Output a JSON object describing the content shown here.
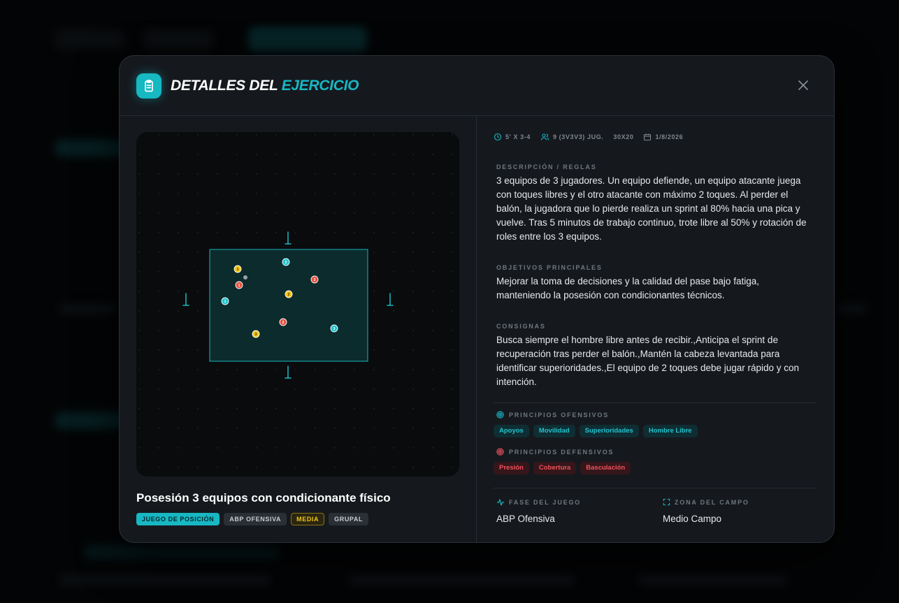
{
  "modal": {
    "title_main": "DETALLES DEL",
    "title_accent": "EJERCICIO",
    "icon": "clipboard-icon",
    "close_icon": "close-icon"
  },
  "exercise": {
    "title": "Posesión 3 equipos con condicionante físico",
    "tags": [
      "JUEGO DE POSICIÓN",
      "ABP OFENSIVA",
      "MEDIA",
      "GRUPAL"
    ]
  },
  "meta": {
    "duration": "5' X 3-4",
    "players": "9 (3V3V3) JUG.",
    "dimensions": "30X20",
    "date": "1/8/2026"
  },
  "description": {
    "label": "DESCRIPCIÓN / REGLAS",
    "text": "3 equipos de 3 jugadores. Un equipo defiende, un equipo atacante juega con toques libres y el otro atacante con máximo 2 toques. Al perder el balón, la jugadora que lo pierde realiza un sprint al 80% hacia una pica y vuelve. Tras 5 minutos de trabajo continuo, trote libre al 50% y rotación de roles entre los 3 equipos."
  },
  "objectives": {
    "label": "OBJETIVOS PRINCIPALES",
    "text": "Mejorar la toma de decisiones y la calidad del pase bajo fatiga, manteniendo la posesión con condicionantes técnicos."
  },
  "consignas": {
    "label": "CONSIGNAS",
    "text": "Busca siempre el hombre libre antes de recibir.,Anticipa el sprint de recuperación tras perder el balón.,Mantén la cabeza levantada para identificar superioridades.,El equipo de 2 toques debe jugar rápido y con intención."
  },
  "principles": {
    "offensive_label": "PRINCIPIOS OFENSIVOS",
    "offensive": [
      "Apoyos",
      "Movilidad",
      "Superioridades",
      "Hombre Libre"
    ],
    "defensive_label": "PRINCIPIOS DEFENSIVOS",
    "defensive": [
      "Presión",
      "Cobertura",
      "Basculación"
    ]
  },
  "fields": {
    "phase_label": "FASE DEL JUEGO",
    "phase_value": "ABP Ofensiva",
    "zone_label": "ZONA DEL CAMPO",
    "zone_value": "Medio Campo"
  },
  "colors": {
    "accent": "#17b8c3",
    "team_yellow": "#f1c514",
    "team_red": "#e8503f",
    "team_cyan": "#1fc3cf"
  },
  "diagram": {
    "players": [
      {
        "team": "yellow",
        "label": "1"
      },
      {
        "team": "cyan",
        "label": "2"
      },
      {
        "team": "red",
        "label": "3"
      },
      {
        "team": "red",
        "label": "1"
      },
      {
        "team": "yellow",
        "label": "2"
      },
      {
        "team": "cyan",
        "label": "1"
      },
      {
        "team": "red",
        "label": "2"
      },
      {
        "team": "cyan",
        "label": "3"
      },
      {
        "team": "yellow",
        "label": "3"
      }
    ]
  }
}
